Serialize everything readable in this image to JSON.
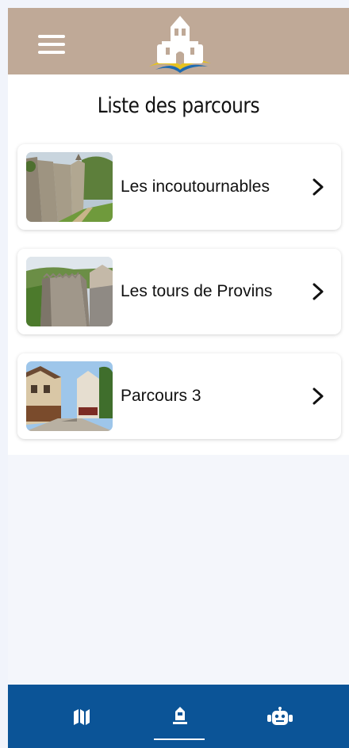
{
  "header": {
    "menu_icon": "hamburger-menu-icon",
    "logo_icon": "castle-logo-icon",
    "colors": {
      "background": "#bfa997",
      "logo_wave_yellow": "#e6c21f",
      "logo_wave_blue": "#1f6bb0"
    }
  },
  "main": {
    "title": "Liste des parcours",
    "routes": [
      {
        "label": "Les incoutournables",
        "thumbnail": "ramparts-photo",
        "chevron_icon": "chevron-right-icon"
      },
      {
        "label": "Les tours de Provins",
        "thumbnail": "tower-photo",
        "chevron_icon": "chevron-right-icon"
      },
      {
        "label": "Parcours 3",
        "thumbnail": "street-photo",
        "chevron_icon": "chevron-right-icon"
      }
    ]
  },
  "bottom_nav": {
    "items": [
      {
        "icon": "map-icon",
        "active": false
      },
      {
        "icon": "tower-icon",
        "active": true
      },
      {
        "icon": "robot-icon",
        "active": false
      }
    ],
    "colors": {
      "background": "#0b5497",
      "foreground": "#ffffff"
    }
  }
}
